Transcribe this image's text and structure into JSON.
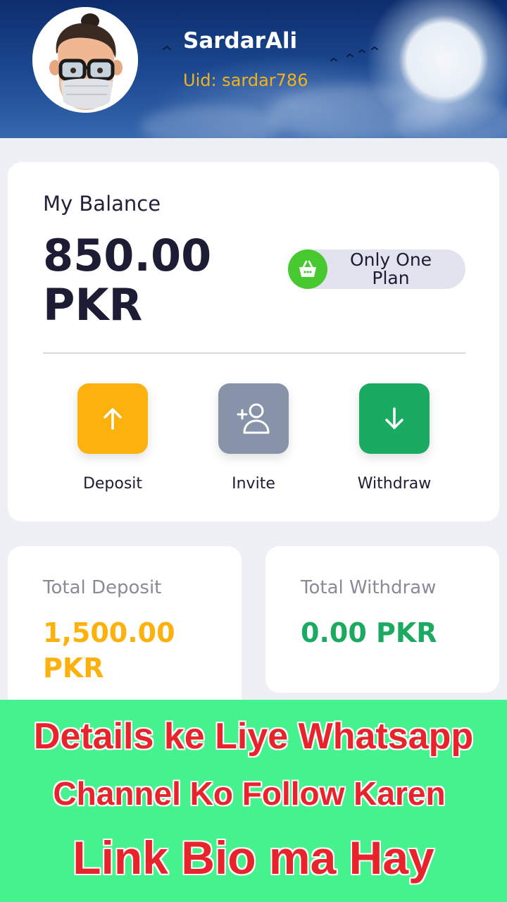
{
  "header": {
    "username": "SardarAli",
    "uid": "Uid: sardar786"
  },
  "balance": {
    "label": "My Balance",
    "amount": "850.00",
    "currency": "PKR",
    "plan_badge": "Only One Plan",
    "plan_icon": "shopping-basket-icon"
  },
  "actions": [
    {
      "label": "Deposit",
      "icon": "arrow-up-icon",
      "color": "#FDB10C"
    },
    {
      "label": "Invite",
      "icon": "add-user-icon",
      "color": "#8693A8"
    },
    {
      "label": "Withdraw",
      "icon": "arrow-down-icon",
      "color": "#1BAA62"
    }
  ],
  "stats": {
    "deposit": {
      "title": "Total Deposit",
      "value": "1,500.00",
      "currency": "PKR",
      "color": "#FDB10C"
    },
    "withdraw": {
      "title": "Total Withdraw",
      "value": "0.00 PKR",
      "color": "#1BAA62"
    }
  },
  "promo": {
    "line1": "Details ke Liye Whatsapp",
    "line2": "Channel Ko Follow Karen",
    "line3": "Link Bio ma Hay",
    "background": "#45F28E",
    "text_color": "#E8232C"
  }
}
